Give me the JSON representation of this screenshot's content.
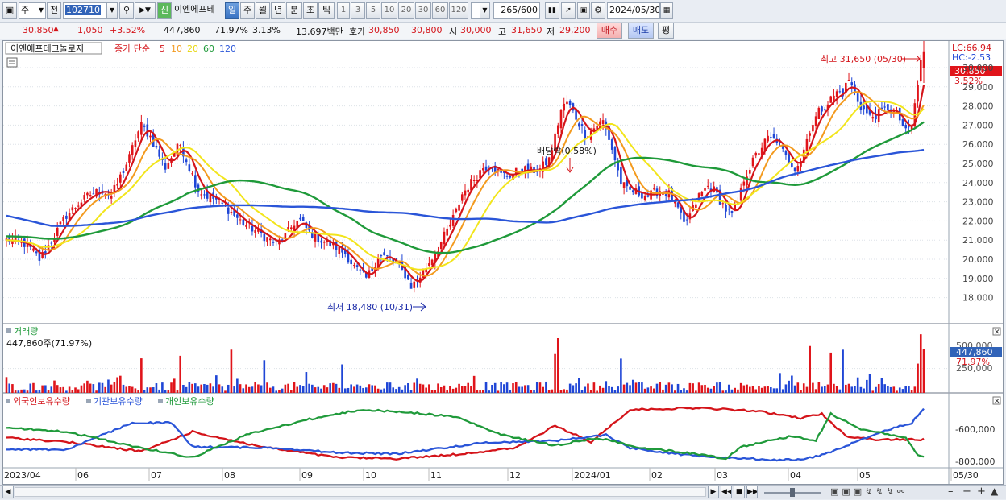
{
  "toolbar": {
    "type_label": "주",
    "all_label": "전",
    "code": "102710",
    "new_badge": "신",
    "stock_name": "이엔에프테",
    "periods": [
      "일",
      "주",
      "월",
      "년",
      "분",
      "초",
      "틱"
    ],
    "selected_period": "일",
    "intervals": [
      "1",
      "3",
      "5",
      "10",
      "20",
      "30",
      "60",
      "120"
    ],
    "count": "265",
    "count_total": "/600",
    "date": "2024/05/30"
  },
  "info": {
    "price": "30,850",
    "change": "1,050",
    "change_pct": "+3.52%",
    "volume": "447,860",
    "volume_ratio": "71.97%",
    "turnover": "3.13%",
    "amount": "13,697백만",
    "ask_label": "호가",
    "ask1": "30,850",
    "ask2": "30,800",
    "open_label": "시",
    "open": "30,000",
    "high_label": "고",
    "high": "31,650",
    "low_label": "저",
    "low": "29,200",
    "buy_btn": "매수",
    "sell_btn": "매도",
    "eval_btn": "평"
  },
  "colors": {
    "up": "#e0141a",
    "down": "#1f46d6",
    "ma5": "#d4141a",
    "ma10": "#f39a1e",
    "ma20": "#f2e51c",
    "ma60": "#1f9a3a",
    "ma120": "#2a55d8"
  },
  "chart_data": {
    "type": "candlestick",
    "price_panel": {
      "title": "이엔에프테크놀로지",
      "ma_label": "종가 단순",
      "ma_periods": [
        "5",
        "10",
        "20",
        "60",
        "120"
      ],
      "yticks": [
        "30,000",
        "29,000",
        "28,000",
        "27,000",
        "26,000",
        "25,000",
        "24,000",
        "23,000",
        "22,000",
        "21,000",
        "20,000",
        "19,000",
        "18,000"
      ],
      "ylim": [
        17700,
        32200
      ],
      "lc_label": "LC:66.94",
      "hc_label": "HC:-2.53",
      "last_price": "30,850",
      "last_pct": "3.52%",
      "high_annot": "최고 31,650 (05/30)",
      "low_annot": "최저 18,480 (10/31)",
      "dividend_annot": "배당락(0.58%)",
      "anchors": [
        [
          0,
          21000
        ],
        [
          3,
          20950
        ],
        [
          6,
          20800
        ],
        [
          9,
          20400
        ],
        [
          11,
          20000
        ],
        [
          14,
          20700
        ],
        [
          17,
          21500
        ],
        [
          20,
          22300
        ],
        [
          24,
          22900
        ],
        [
          28,
          23400
        ],
        [
          32,
          23600
        ],
        [
          35,
          23300
        ],
        [
          38,
          24300
        ],
        [
          41,
          25300
        ],
        [
          43,
          26300
        ],
        [
          45,
          27000
        ],
        [
          48,
          26400
        ],
        [
          51,
          25400
        ],
        [
          53,
          24800
        ],
        [
          56,
          25600
        ],
        [
          58,
          26000
        ],
        [
          61,
          24800
        ],
        [
          64,
          23600
        ],
        [
          67,
          23300
        ],
        [
          70,
          23100
        ],
        [
          74,
          22600
        ],
        [
          78,
          22000
        ],
        [
          82,
          21600
        ],
        [
          86,
          21200
        ],
        [
          90,
          20800
        ],
        [
          93,
          21200
        ],
        [
          96,
          21900
        ],
        [
          98,
          22000
        ],
        [
          101,
          21400
        ],
        [
          105,
          21000
        ],
        [
          109,
          20700
        ],
        [
          113,
          20300
        ],
        [
          116,
          19600
        ],
        [
          120,
          19000
        ],
        [
          122,
          19500
        ],
        [
          124,
          20200
        ],
        [
          127,
          20100
        ],
        [
          130,
          19700
        ],
        [
          133,
          19200
        ],
        [
          135,
          18600
        ],
        [
          137,
          18900
        ],
        [
          140,
          19600
        ],
        [
          144,
          20600
        ],
        [
          148,
          21800
        ],
        [
          150,
          22500
        ],
        [
          152,
          23400
        ],
        [
          156,
          24200
        ],
        [
          159,
          24800
        ],
        [
          162,
          24900
        ],
        [
          165,
          24400
        ],
        [
          168,
          24400
        ],
        [
          172,
          24700
        ],
        [
          175,
          24600
        ],
        [
          178,
          24700
        ],
        [
          181,
          25200
        ],
        [
          183,
          26400
        ],
        [
          185,
          27800
        ],
        [
          187,
          28200
        ],
        [
          190,
          27400
        ],
        [
          193,
          26500
        ],
        [
          195,
          26700
        ],
        [
          197,
          27000
        ],
        [
          199,
          27200
        ],
        [
          201,
          26300
        ],
        [
          203,
          25200
        ],
        [
          205,
          24000
        ],
        [
          207,
          23600
        ],
        [
          210,
          23500
        ],
        [
          214,
          23300
        ],
        [
          218,
          23600
        ],
        [
          221,
          23400
        ],
        [
          224,
          22600
        ],
        [
          226,
          21800
        ],
        [
          228,
          22300
        ],
        [
          231,
          23300
        ],
        [
          234,
          23800
        ],
        [
          236,
          23600
        ],
        [
          238,
          23100
        ],
        [
          240,
          22600
        ],
        [
          242,
          22300
        ],
        [
          244,
          22900
        ],
        [
          246,
          24200
        ],
        [
          248,
          24800
        ],
        [
          250,
          25400
        ],
        [
          252,
          25900
        ],
        [
          254,
          26300
        ],
        [
          257,
          26200
        ],
        [
          260,
          25300
        ],
        [
          263,
          24800
        ],
        [
          265,
          25200
        ],
        [
          268,
          26800
        ],
        [
          271,
          27700
        ],
        [
          274,
          28200
        ],
        [
          277,
          28700
        ],
        [
          279,
          28700
        ],
        [
          281,
          29400
        ],
        [
          283,
          28600
        ],
        [
          285,
          28000
        ],
        [
          288,
          27400
        ],
        [
          291,
          27600
        ],
        [
          294,
          27900
        ],
        [
          296,
          27700
        ],
        [
          298,
          27300
        ],
        [
          300,
          26600
        ],
        [
          302,
          27000
        ],
        [
          304,
          29100
        ],
        [
          305,
          30400
        ],
        [
          306,
          30850
        ]
      ],
      "markers": [
        {
          "label": "최저",
          "index": 135,
          "price": 18480
        },
        {
          "label": "최고",
          "index": 306,
          "price": 31650
        },
        {
          "label": "배당락",
          "index": 182,
          "price": 26300
        }
      ]
    },
    "volume_panel": {
      "title": "거래량",
      "info": "447,860주(71.97%)",
      "yticks": [
        "500,000",
        "250,000"
      ],
      "ylim": [
        0,
        700000
      ],
      "last_volume": "447,860",
      "last_ratio": "71.97%"
    },
    "holder_panel": {
      "series": [
        {
          "name": "외국인보유수량",
          "color": "#d4141a",
          "anchors": [
            [
              0,
              0.55
            ],
            [
              20,
              0.62
            ],
            [
              45,
              0.78
            ],
            [
              62,
              0.45
            ],
            [
              85,
              0.7
            ],
            [
              110,
              0.88
            ],
            [
              130,
              0.9
            ],
            [
              150,
              0.83
            ],
            [
              170,
              0.72
            ],
            [
              183,
              0.35
            ],
            [
              195,
              0.62
            ],
            [
              208,
              0.08
            ],
            [
              230,
              0.05
            ],
            [
              250,
              0.1
            ],
            [
              265,
              0.22
            ],
            [
              272,
              0.15
            ],
            [
              280,
              0.52
            ],
            [
              290,
              0.58
            ],
            [
              306,
              0.58
            ]
          ]
        },
        {
          "name": "기관보유수량",
          "color": "#2a55d8",
          "anchors": [
            [
              0,
              0.74
            ],
            [
              20,
              0.75
            ],
            [
              42,
              0.3
            ],
            [
              55,
              0.3
            ],
            [
              62,
              0.7
            ],
            [
              90,
              0.72
            ],
            [
              110,
              0.8
            ],
            [
              130,
              0.82
            ],
            [
              160,
              0.63
            ],
            [
              183,
              0.6
            ],
            [
              200,
              0.5
            ],
            [
              208,
              0.72
            ],
            [
              225,
              0.83
            ],
            [
              240,
              0.88
            ],
            [
              255,
              0.92
            ],
            [
              265,
              0.92
            ],
            [
              272,
              0.84
            ],
            [
              295,
              0.4
            ],
            [
              302,
              0.3
            ],
            [
              306,
              0.05
            ]
          ]
        },
        {
          "name": "개인보유수량",
          "color": "#1f9a3a",
          "anchors": [
            [
              0,
              0.38
            ],
            [
              20,
              0.45
            ],
            [
              45,
              0.72
            ],
            [
              62,
              0.88
            ],
            [
              80,
              0.5
            ],
            [
              100,
              0.25
            ],
            [
              118,
              0.08
            ],
            [
              133,
              0.12
            ],
            [
              150,
              0.2
            ],
            [
              165,
              0.5
            ],
            [
              183,
              0.68
            ],
            [
              197,
              0.55
            ],
            [
              212,
              0.72
            ],
            [
              230,
              0.82
            ],
            [
              240,
              0.9
            ],
            [
              245,
              0.7
            ],
            [
              262,
              0.52
            ],
            [
              270,
              0.6
            ],
            [
              275,
              0.15
            ],
            [
              285,
              0.4
            ],
            [
              300,
              0.55
            ],
            [
              304,
              0.85
            ],
            [
              306,
              0.86
            ]
          ]
        }
      ],
      "yticks": [
        "-600,000",
        "-800,000"
      ]
    },
    "x_labels": [
      "2023/04",
      "06",
      "07",
      "08",
      "09",
      "10",
      "11",
      "12",
      "2024/01",
      "02",
      "03",
      "04",
      "05",
      "05/30"
    ]
  }
}
